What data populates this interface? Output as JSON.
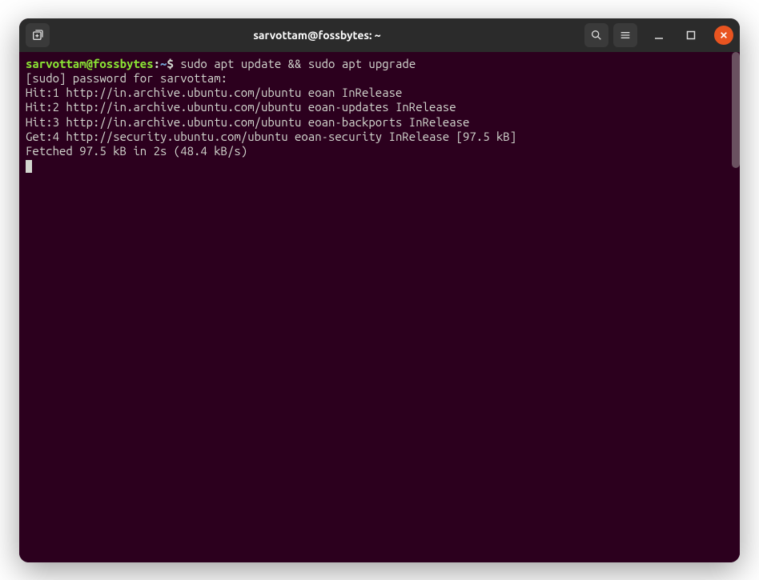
{
  "titlebar": {
    "title": "sarvottam@fossbytes: ~"
  },
  "prompt": {
    "user_host": "sarvottam@fossbytes",
    "colon": ":",
    "path": "~",
    "symbol": "$"
  },
  "terminal": {
    "command": "sudo apt update && sudo apt upgrade",
    "lines": [
      "[sudo] password for sarvottam:",
      "Hit:1 http://in.archive.ubuntu.com/ubuntu eoan InRelease",
      "Hit:2 http://in.archive.ubuntu.com/ubuntu eoan-updates InRelease",
      "Hit:3 http://in.archive.ubuntu.com/ubuntu eoan-backports InRelease",
      "Get:4 http://security.ubuntu.com/ubuntu eoan-security InRelease [97.5 kB]",
      "Fetched 97.5 kB in 2s (48.4 kB/s)"
    ]
  }
}
